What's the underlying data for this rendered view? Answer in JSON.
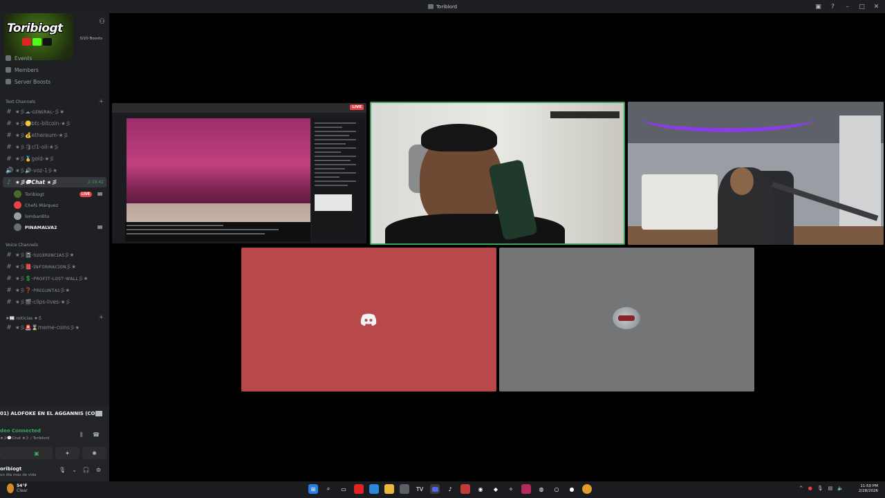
{
  "window": {
    "title": "Toriblord"
  },
  "server": {
    "logo_text": "Toribiogt",
    "boosts": "0/20 Boosts"
  },
  "nav": [
    {
      "label": "Events"
    },
    {
      "label": "Members"
    },
    {
      "label": "Server Boosts"
    }
  ],
  "text_category": {
    "label": "Text Channels"
  },
  "text_channels": [
    {
      "label": "★彡☁-ɢᴇɴᴇʀᴀʟ-彡★"
    },
    {
      "label": "★彡🪙btc-bitcoin-★彡"
    },
    {
      "label": "★彡💰ethereum-★彡"
    },
    {
      "label": "★彡🛢cl1-oil-★彡"
    },
    {
      "label": "★彡🥇gold-★彡"
    },
    {
      "label": "★彡🔊-voz-1彡★"
    }
  ],
  "active_channel": {
    "label": "★彡💬Chat ★彡",
    "time": "2:59:41"
  },
  "voice_users": [
    {
      "name": "Toribiogt",
      "live": "LIVE"
    },
    {
      "name": "Chefs Márquez"
    },
    {
      "name": "lombardito"
    },
    {
      "name": "PINAMALVA2"
    }
  ],
  "voice_category": {
    "label": "Voice Channels"
  },
  "voice_channels": [
    {
      "label": "★彡📓-sᴜɢᴇʀᴇɴᴄɪᴀs彡★"
    },
    {
      "label": "★彡📕-ɪɴғᴏʀᴍᴀᴄɪᴏɴ彡★"
    },
    {
      "label": "★彡💲-ᴘʀᴏғɪᴛ-ʟᴏsᴛ-ᴡᴀʟʟ彡★"
    },
    {
      "label": "★彡❓-ᴘʀᴇɢᴜɴᴛᴀs彡★"
    },
    {
      "label": "★彡🎬-clips-lives-★彡"
    }
  ],
  "noticias_category": {
    "label": "★📰 noticias ★彡"
  },
  "noticias_channels": [
    {
      "label": "★彡🚨⌛meme-coins彡★"
    }
  ],
  "voice_panel": {
    "stream_title": "01) ALOFOKE EN EL AGGANNIS (CO...",
    "connected": "deo Connected",
    "channel": "★彡💬Chat ★彡 / Toriblord"
  },
  "user_panel": {
    "name": "oribiogt",
    "status": "un dia mas de vida"
  },
  "stage": {
    "live": "LIVE"
  },
  "taskbar": {
    "temp": "54°F",
    "weather": "Clear",
    "time": "11:50 PM",
    "date": "2/28/2026"
  },
  "colors": {
    "accent_green": "#3ba55d",
    "live_red": "#ed4245",
    "tile_red": "#b8484a",
    "tile_gray": "#747577"
  }
}
